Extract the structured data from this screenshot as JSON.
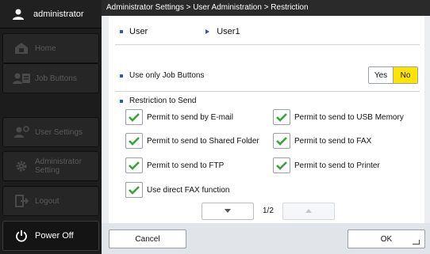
{
  "sidebar": {
    "user_label": "administrator",
    "items": [
      {
        "label": "Home",
        "icon": "home-icon"
      },
      {
        "label": "Job Buttons",
        "icon": "job-buttons-icon"
      },
      {
        "label": "User Settings",
        "icon": "user-settings-icon"
      },
      {
        "label": "Administrator Setting",
        "icon": "gear-icon"
      },
      {
        "label": "Logout",
        "icon": "logout-icon"
      }
    ],
    "power_label": "Power Off"
  },
  "breadcrumb": "Administrator Settings > User Administration > Restriction",
  "user_row": {
    "label": "User",
    "value": "User1"
  },
  "job_buttons_only": {
    "label": "Use only Job Buttons",
    "yes_label": "Yes",
    "no_label": "No",
    "selected": "No"
  },
  "restriction": {
    "title": "Restriction to Send",
    "permissions": [
      {
        "label": "Permit to send by E-mail",
        "checked": true
      },
      {
        "label": "Permit to send to USB Memory",
        "checked": true
      },
      {
        "label": "Permit to send to Shared Folder",
        "checked": true
      },
      {
        "label": "Permit to send to FAX",
        "checked": true
      },
      {
        "label": "Permit to send to FTP",
        "checked": true
      },
      {
        "label": "Permit to send to Printer",
        "checked": true
      },
      {
        "label": "Use direct FAX function",
        "checked": true
      }
    ]
  },
  "pager": {
    "label": "1/2"
  },
  "footer": {
    "cancel_label": "Cancel",
    "ok_label": "OK"
  },
  "colors": {
    "selected_yellow": "#ffe400",
    "check_green": "#3aa23a",
    "bullet_blue": "#2c5ab8"
  }
}
